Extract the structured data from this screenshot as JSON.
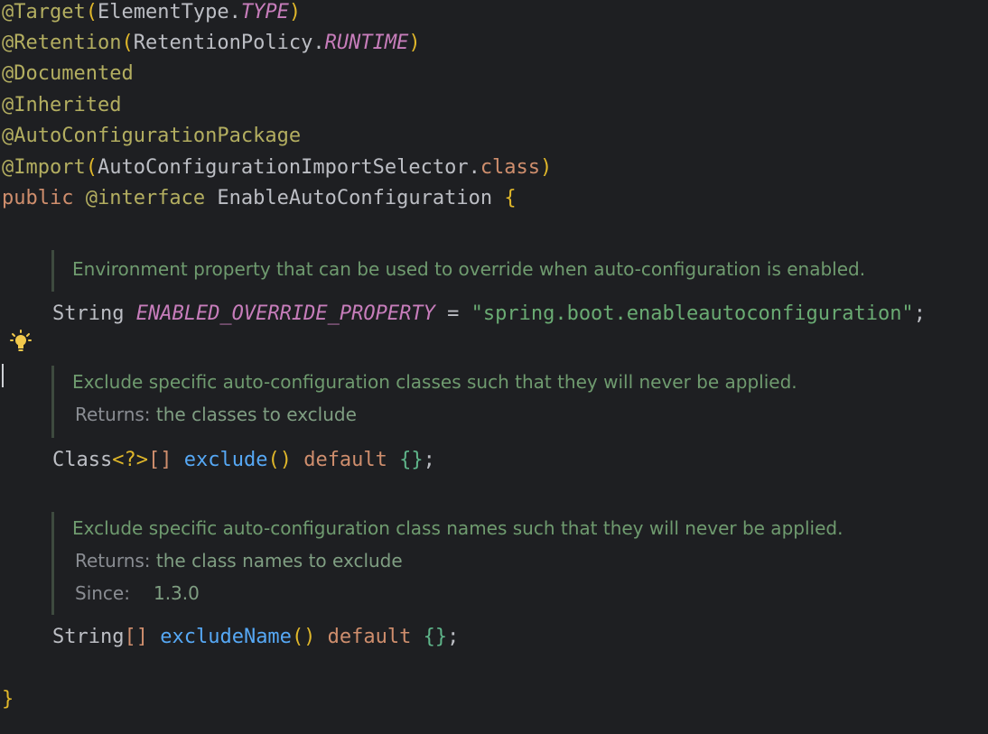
{
  "code": {
    "l1": {
      "at": "@Target",
      "open": "(",
      "cls": "ElementType.",
      "const": "TYPE",
      "close": ")"
    },
    "l2": {
      "at": "@Retention",
      "open": "(",
      "cls": "RetentionPolicy.",
      "const": "RUNTIME",
      "close": ")"
    },
    "l3": {
      "at": "@Documented"
    },
    "l4": {
      "at": "@Inherited"
    },
    "l5": {
      "at": "@AutoConfigurationPackage"
    },
    "l6": {
      "at": "@Import",
      "open": "(",
      "cls": "AutoConfigurationImportSelector.",
      "kw": "class",
      "close": ")"
    },
    "l7": {
      "kw1": "public ",
      "kw2": "@interface ",
      "name": "EnableAutoConfiguration ",
      "brace": "{"
    },
    "field": {
      "type": "String ",
      "name": "ENABLED_OVERRIDE_PROPERTY",
      "eq": " = ",
      "value": "\"spring.boot.enableautoconfiguration\"",
      "semi": ";"
    },
    "exclude": {
      "type": "Class",
      "generic": "<?>",
      "arr": "[]",
      "name": " exclude",
      "parens": "()",
      "kw": " default ",
      "braces": "{}",
      "semi": ";"
    },
    "excludeName": {
      "type": "String",
      "arr": "[]",
      "name": " excludeName",
      "parens": "()",
      "kw": " default ",
      "braces": "{}",
      "semi": ";"
    },
    "end": "}"
  },
  "docs": {
    "d1": {
      "text": "Environment property that can be used to override when auto-configuration is enabled."
    },
    "d2": {
      "text": "Exclude specific auto-configuration classes such that they will never be applied.",
      "returns_label": "Returns:",
      "returns_value": "the classes to exclude"
    },
    "d3": {
      "text": "Exclude specific auto-configuration class names such that they will never be applied.",
      "returns_label": "Returns:",
      "returns_value": "the class names to exclude",
      "since_label": "Since:",
      "since_value": "1.3.0"
    }
  },
  "icons": {
    "bulb": "lightbulb-icon"
  },
  "colors": {
    "background": "#1e1f22",
    "annotation": "#b3ae60",
    "keyword": "#cf8e6d",
    "string": "#6aab73",
    "function": "#56a8f5",
    "constant": "#c77dbb",
    "doc": "#6f9b6f"
  }
}
